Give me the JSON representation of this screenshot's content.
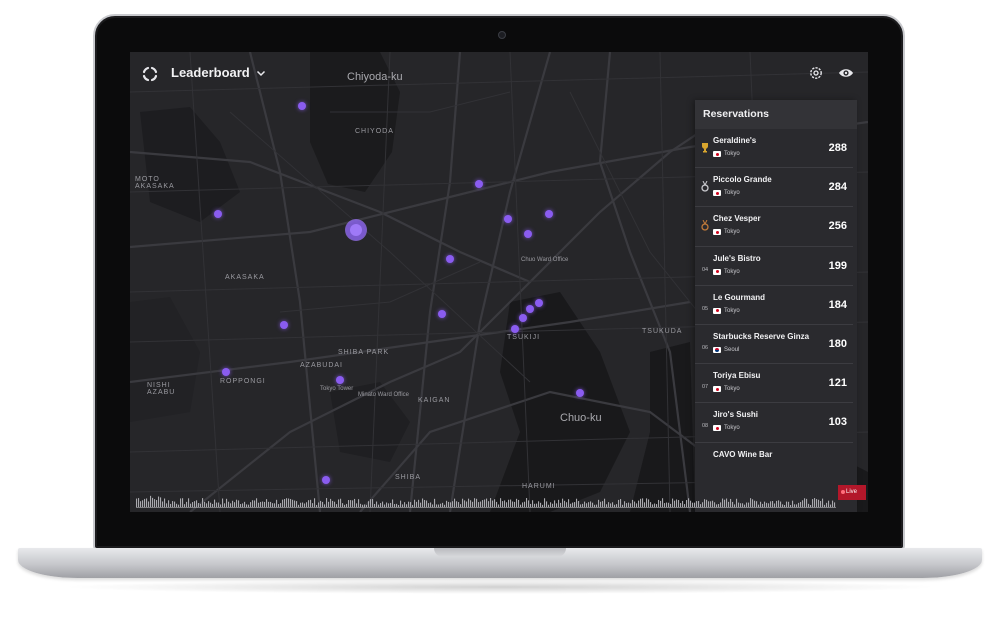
{
  "app": {
    "title": "Leaderboard",
    "accent_color": "#8a5cf0"
  },
  "map": {
    "labels": [
      {
        "text": "Chiyoda-ku",
        "size": "big"
      },
      {
        "text": "CHIYODA",
        "size": "small"
      },
      {
        "text": "MOTO AKASAKA",
        "size": "small"
      },
      {
        "text": "AKASAKA",
        "size": "small"
      },
      {
        "text": "SHIBA PARK",
        "size": "small"
      },
      {
        "text": "ROPPONGI",
        "size": "small"
      },
      {
        "text": "NISHI AZABU",
        "size": "small"
      },
      {
        "text": "AZABUDAI",
        "size": "small"
      },
      {
        "text": "Minato Ward Office",
        "size": "small"
      },
      {
        "text": "Tokyo Tower",
        "size": "small"
      },
      {
        "text": "KAIGAN",
        "size": "small"
      },
      {
        "text": "TSUKIJI",
        "size": "small"
      },
      {
        "text": "TSUKUDA",
        "size": "small"
      },
      {
        "text": "Chuo Ward Office",
        "size": "small"
      },
      {
        "text": "Chuo-ku",
        "size": "big"
      },
      {
        "text": "SHIBA",
        "size": "small"
      },
      {
        "text": "HARUMI",
        "size": "small"
      }
    ],
    "icons": [
      "settings-icon",
      "eye-icon"
    ]
  },
  "panel": {
    "title": "Reservations",
    "rows": [
      {
        "rank": "",
        "rank_icon": "trophy-icon",
        "name": "Geraldine's",
        "flag": "jp",
        "city": "Tokyo",
        "score": "288"
      },
      {
        "rank": "",
        "rank_icon": "silver-medal-icon",
        "name": "Piccolo Grande",
        "flag": "jp",
        "city": "Tokyo",
        "score": "284"
      },
      {
        "rank": "",
        "rank_icon": "bronze-medal-icon",
        "name": "Chez Vesper",
        "flag": "jp",
        "city": "Tokyo",
        "score": "256"
      },
      {
        "rank": "04",
        "rank_icon": "",
        "name": "Jule's Bistro",
        "flag": "jp",
        "city": "Tokyo",
        "score": "199"
      },
      {
        "rank": "05",
        "rank_icon": "",
        "name": "Le Gourmand",
        "flag": "jp",
        "city": "Tokyo",
        "score": "184"
      },
      {
        "rank": "06",
        "rank_icon": "",
        "name": "Starbucks Reserve Ginza",
        "flag": "kr",
        "city": "Seoul",
        "score": "180"
      },
      {
        "rank": "07",
        "rank_icon": "",
        "name": "Toriya Ebisu",
        "flag": "jp",
        "city": "Tokyo",
        "score": "121"
      },
      {
        "rank": "08",
        "rank_icon": "",
        "name": "Jiro's Sushi",
        "flag": "jp",
        "city": "Tokyo",
        "score": "103"
      },
      {
        "rank": "",
        "rank_icon": "",
        "name": "CAVO Wine Bar",
        "flag": "",
        "city": "",
        "score": ""
      }
    ]
  },
  "timeline": {
    "live_label": "Live",
    "live_color": "#b3172a"
  }
}
